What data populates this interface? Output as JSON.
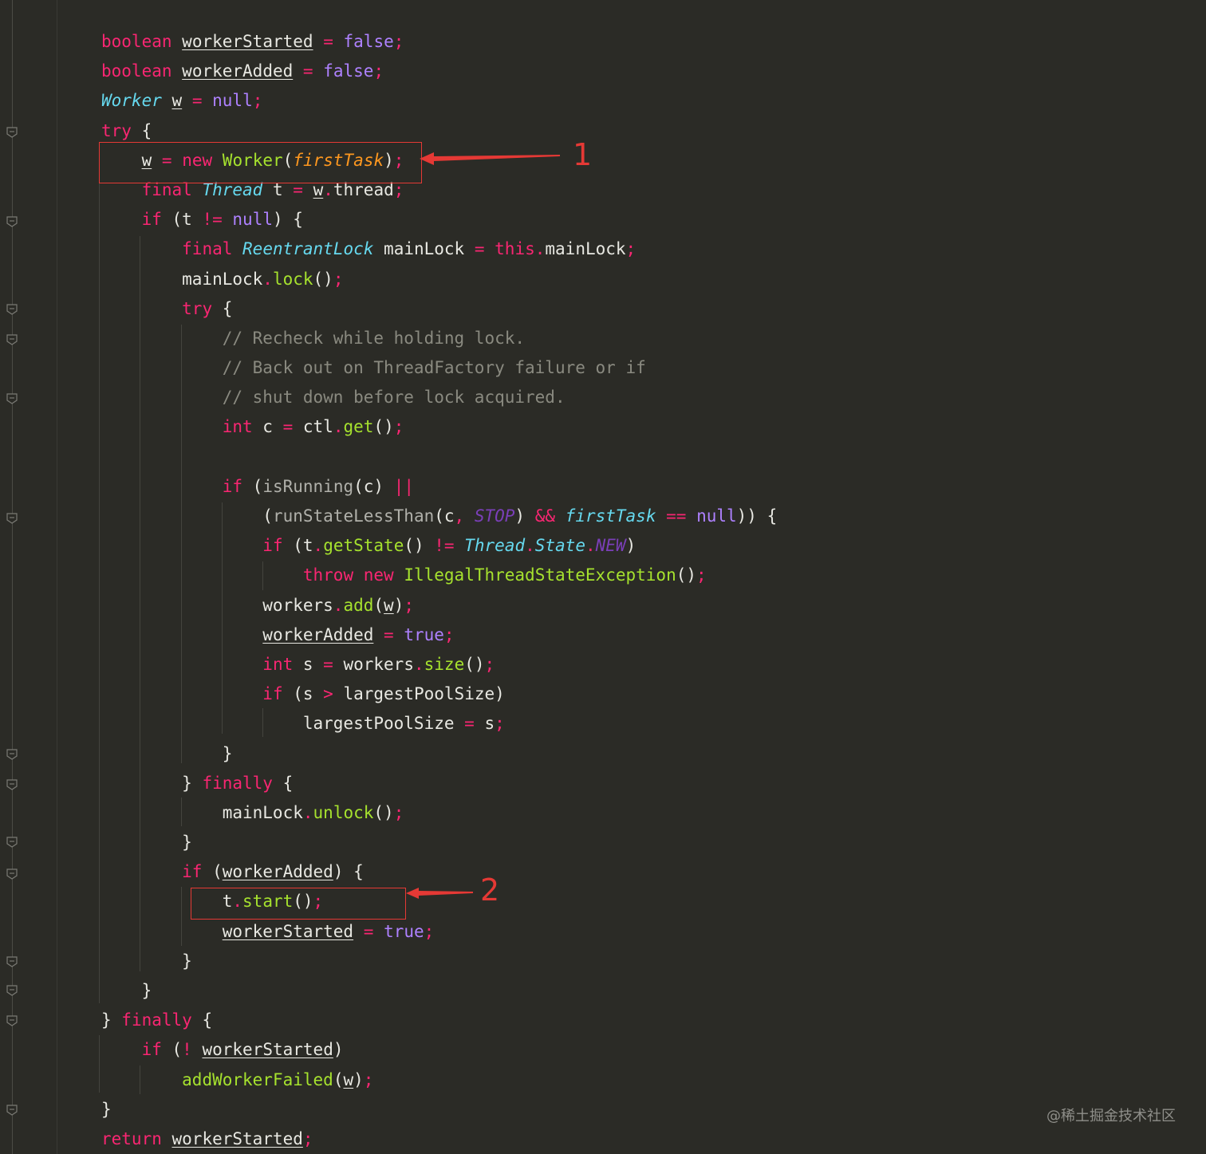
{
  "code_lines": [
    [
      [
        "kw",
        "boolean"
      ],
      [
        "p",
        " "
      ],
      [
        "vu",
        "workerStarted"
      ],
      [
        "p",
        " "
      ],
      [
        "pu",
        "="
      ],
      [
        "p",
        " "
      ],
      [
        "lit",
        "false"
      ],
      [
        "pu",
        ";"
      ]
    ],
    [
      [
        "kw",
        "boolean"
      ],
      [
        "p",
        " "
      ],
      [
        "vu",
        "workerAdded"
      ],
      [
        "p",
        " "
      ],
      [
        "pu",
        "="
      ],
      [
        "p",
        " "
      ],
      [
        "lit",
        "false"
      ],
      [
        "pu",
        ";"
      ]
    ],
    [
      [
        "ty",
        "Worker"
      ],
      [
        "p",
        " "
      ],
      [
        "vu",
        "w"
      ],
      [
        "p",
        " "
      ],
      [
        "pu",
        "="
      ],
      [
        "p",
        " "
      ],
      [
        "lit",
        "null"
      ],
      [
        "pu",
        ";"
      ]
    ],
    [
      [
        "kw",
        "try"
      ],
      [
        "p",
        " {"
      ]
    ],
    [
      [
        "p",
        "    "
      ],
      [
        "vu",
        "w"
      ],
      [
        "p",
        " "
      ],
      [
        "pu",
        "="
      ],
      [
        "p",
        " "
      ],
      [
        "kw",
        "new"
      ],
      [
        "p",
        " "
      ],
      [
        "fn",
        "Worker"
      ],
      [
        "p",
        "("
      ],
      [
        "pa",
        "firstTask"
      ],
      [
        "p",
        ")"
      ],
      [
        "pu",
        ";"
      ]
    ],
    [
      [
        "p",
        "    "
      ],
      [
        "kw",
        "final"
      ],
      [
        "p",
        " "
      ],
      [
        "ty",
        "Thread"
      ],
      [
        "p",
        " t "
      ],
      [
        "pu",
        "="
      ],
      [
        "p",
        " "
      ],
      [
        "vu",
        "w"
      ],
      [
        "pu",
        "."
      ],
      [
        "p",
        "thread"
      ],
      [
        "pu",
        ";"
      ]
    ],
    [
      [
        "p",
        "    "
      ],
      [
        "kw",
        "if"
      ],
      [
        "p",
        " (t "
      ],
      [
        "pu",
        "!="
      ],
      [
        "p",
        " "
      ],
      [
        "lit",
        "null"
      ],
      [
        "p",
        ") {"
      ]
    ],
    [
      [
        "p",
        "        "
      ],
      [
        "kw",
        "final"
      ],
      [
        "p",
        " "
      ],
      [
        "ty",
        "ReentrantLock"
      ],
      [
        "p",
        " mainLock "
      ],
      [
        "pu",
        "="
      ],
      [
        "p",
        " "
      ],
      [
        "kw",
        "this"
      ],
      [
        "pu",
        "."
      ],
      [
        "p",
        "mainLock"
      ],
      [
        "pu",
        ";"
      ]
    ],
    [
      [
        "p",
        "        mainLock"
      ],
      [
        "pu",
        "."
      ],
      [
        "fn",
        "lock"
      ],
      [
        "p",
        "()"
      ],
      [
        "pu",
        ";"
      ]
    ],
    [
      [
        "p",
        "        "
      ],
      [
        "kw",
        "try"
      ],
      [
        "p",
        " {"
      ]
    ],
    [
      [
        "p",
        "            "
      ],
      [
        "cm",
        "// Recheck while holding lock."
      ]
    ],
    [
      [
        "p",
        "            "
      ],
      [
        "cm",
        "// Back out on ThreadFactory failure or if"
      ]
    ],
    [
      [
        "p",
        "            "
      ],
      [
        "cm",
        "// shut down before lock acquired."
      ]
    ],
    [
      [
        "p",
        "            "
      ],
      [
        "kw",
        "int"
      ],
      [
        "p",
        " c "
      ],
      [
        "pu",
        "="
      ],
      [
        "p",
        " ctl"
      ],
      [
        "pu",
        "."
      ],
      [
        "fn",
        "get"
      ],
      [
        "p",
        "()"
      ],
      [
        "pu",
        ";"
      ]
    ],
    [
      [
        "p",
        " "
      ]
    ],
    [
      [
        "p",
        "            "
      ],
      [
        "kw",
        "if"
      ],
      [
        "p",
        " ("
      ],
      [
        "fng",
        "isRunning"
      ],
      [
        "p",
        "(c) "
      ],
      [
        "pu",
        "||"
      ]
    ],
    [
      [
        "p",
        "                ("
      ],
      [
        "fng",
        "runStateLessThan"
      ],
      [
        "p",
        "(c"
      ],
      [
        "pu",
        ","
      ],
      [
        "p",
        " "
      ],
      [
        "cst",
        "STOP"
      ],
      [
        "p",
        ") "
      ],
      [
        "pu",
        "&&"
      ],
      [
        "p",
        " "
      ],
      [
        "fi",
        "firstTask"
      ],
      [
        "p",
        " "
      ],
      [
        "pu",
        "=="
      ],
      [
        "p",
        " "
      ],
      [
        "lit",
        "null"
      ],
      [
        "p",
        ")) {"
      ]
    ],
    [
      [
        "p",
        "                "
      ],
      [
        "kw",
        "if"
      ],
      [
        "p",
        " (t"
      ],
      [
        "pu",
        "."
      ],
      [
        "fn",
        "getState"
      ],
      [
        "p",
        "() "
      ],
      [
        "pu",
        "!="
      ],
      [
        "p",
        " "
      ],
      [
        "ty",
        "Thread"
      ],
      [
        "pu",
        "."
      ],
      [
        "ty",
        "State"
      ],
      [
        "pu",
        "."
      ],
      [
        "cst",
        "NEW"
      ],
      [
        "p",
        ")"
      ]
    ],
    [
      [
        "p",
        "                    "
      ],
      [
        "kw",
        "throw"
      ],
      [
        "p",
        " "
      ],
      [
        "kw",
        "new"
      ],
      [
        "p",
        " "
      ],
      [
        "fn",
        "IllegalThreadStateException"
      ],
      [
        "p",
        "()"
      ],
      [
        "pu",
        ";"
      ]
    ],
    [
      [
        "p",
        "                workers"
      ],
      [
        "pu",
        "."
      ],
      [
        "fn",
        "add"
      ],
      [
        "p",
        "("
      ],
      [
        "vu",
        "w"
      ],
      [
        "p",
        ")"
      ],
      [
        "pu",
        ";"
      ]
    ],
    [
      [
        "p",
        "                "
      ],
      [
        "vu",
        "workerAdded"
      ],
      [
        "p",
        " "
      ],
      [
        "pu",
        "="
      ],
      [
        "p",
        " "
      ],
      [
        "lit",
        "true"
      ],
      [
        "pu",
        ";"
      ]
    ],
    [
      [
        "p",
        "                "
      ],
      [
        "kw",
        "int"
      ],
      [
        "p",
        " s "
      ],
      [
        "pu",
        "="
      ],
      [
        "p",
        " workers"
      ],
      [
        "pu",
        "."
      ],
      [
        "fn",
        "size"
      ],
      [
        "p",
        "()"
      ],
      [
        "pu",
        ";"
      ]
    ],
    [
      [
        "p",
        "                "
      ],
      [
        "kw",
        "if"
      ],
      [
        "p",
        " (s "
      ],
      [
        "pu",
        ">"
      ],
      [
        "p",
        " largestPoolSize)"
      ]
    ],
    [
      [
        "p",
        "                    largestPoolSize "
      ],
      [
        "pu",
        "="
      ],
      [
        "p",
        " s"
      ],
      [
        "pu",
        ";"
      ]
    ],
    [
      [
        "p",
        "            }"
      ]
    ],
    [
      [
        "p",
        "        } "
      ],
      [
        "kw",
        "finally"
      ],
      [
        "p",
        " {"
      ]
    ],
    [
      [
        "p",
        "            mainLock"
      ],
      [
        "pu",
        "."
      ],
      [
        "fn",
        "unlock"
      ],
      [
        "p",
        "()"
      ],
      [
        "pu",
        ";"
      ]
    ],
    [
      [
        "p",
        "        }"
      ]
    ],
    [
      [
        "p",
        "        "
      ],
      [
        "kw",
        "if"
      ],
      [
        "p",
        " ("
      ],
      [
        "vu",
        "workerAdded"
      ],
      [
        "p",
        ") {"
      ]
    ],
    [
      [
        "p",
        "            t"
      ],
      [
        "pu",
        "."
      ],
      [
        "fn",
        "start"
      ],
      [
        "p",
        "()"
      ],
      [
        "pu",
        ";"
      ]
    ],
    [
      [
        "p",
        "            "
      ],
      [
        "vu",
        "workerStarted"
      ],
      [
        "p",
        " "
      ],
      [
        "pu",
        "="
      ],
      [
        "p",
        " "
      ],
      [
        "lit",
        "true"
      ],
      [
        "pu",
        ";"
      ]
    ],
    [
      [
        "p",
        "        }"
      ]
    ],
    [
      [
        "p",
        "    }"
      ]
    ],
    [
      [
        "p",
        "} "
      ],
      [
        "kw",
        "finally"
      ],
      [
        "p",
        " {"
      ]
    ],
    [
      [
        "p",
        "    "
      ],
      [
        "kw",
        "if"
      ],
      [
        "p",
        " ("
      ],
      [
        "pu",
        "!"
      ],
      [
        "p",
        " "
      ],
      [
        "vu",
        "workerStarted"
      ],
      [
        "p",
        ")"
      ]
    ],
    [
      [
        "p",
        "        "
      ],
      [
        "fn",
        "addWorkerFailed"
      ],
      [
        "p",
        "("
      ],
      [
        "vu",
        "w"
      ],
      [
        "p",
        ")"
      ],
      [
        "pu",
        ";"
      ]
    ],
    [
      [
        "p",
        "}"
      ]
    ],
    [
      [
        "kw",
        "return"
      ],
      [
        "p",
        " "
      ],
      [
        "vu",
        "workerStarted"
      ],
      [
        "pu",
        ";"
      ]
    ]
  ],
  "annotations": {
    "label_1": "1",
    "label_2": "2"
  },
  "watermark": "@稀土掘金技术社区",
  "colors": {
    "background": "#2b2b26",
    "keyword": "#f92672",
    "type": "#66d9ef",
    "function": "#a6e22e",
    "literal": "#ae81ff",
    "comment": "#8a8a80",
    "annotation": "#e53935"
  }
}
